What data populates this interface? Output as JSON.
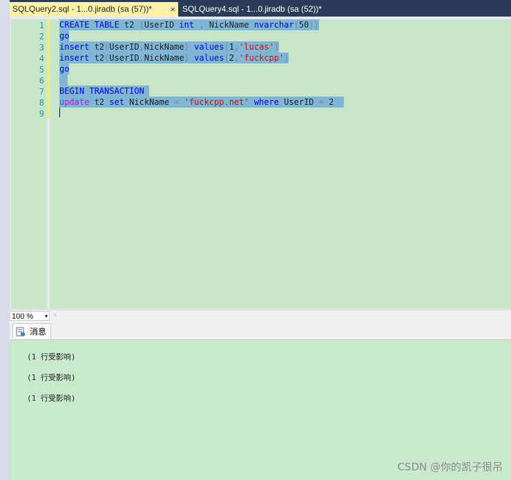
{
  "tabs": [
    {
      "label": "SQLQuery2.sql - 1...0.jiradb (sa (57))*",
      "active": true,
      "close": "×"
    },
    {
      "label": "SQLQuery4.sql - 1...0.jiradb (sa (52))*",
      "active": false
    }
  ],
  "editor": {
    "line_numbers": [
      "1",
      "2",
      "3",
      "4",
      "5",
      "6",
      "7",
      "8",
      "9"
    ],
    "code": {
      "l1": {
        "kw1": "CREATE TABLE",
        "t1": " t2 ",
        "p1": "(",
        "t2": "UserID ",
        "kw2": "int",
        "t3": " ",
        "p2": ",",
        "t4": " NickName ",
        "kw3": "nvarchar",
        "p3": "(",
        "t5": "50",
        "p4": "))"
      },
      "l2": {
        "kw1": "go"
      },
      "l3": {
        "kw1": "insert",
        "t1": " t2",
        "p1": "(",
        "t2": "UserID",
        "p2": ",",
        "t3": "NickName",
        "p3": ")",
        "t4": " ",
        "kw2": "values",
        "p4": "(",
        "t5": "1",
        "p5": ",",
        "s1": "'lucas'",
        "p6": ")"
      },
      "l4": {
        "kw1": "insert",
        "t1": " t2",
        "p1": "(",
        "t2": "UserID",
        "p2": ",",
        "t3": "NickName",
        "p3": ")",
        "t4": " ",
        "kw2": "values",
        "p4": "(",
        "t5": "2",
        "p5": ",",
        "s1": "'fuckcpp'",
        "p6": ")"
      },
      "l5": {
        "kw1": "go"
      },
      "l7": {
        "kw1": "BEGIN TRANSACTION"
      },
      "l8": {
        "kw1": "update",
        "t1": " t2 ",
        "kw2": "set",
        "t2": " NickName ",
        "p1": "=",
        "t3": " ",
        "s1": "'fuckcpp.net'",
        "t4": " ",
        "kw3": "where",
        "t5": " UserID ",
        "p2": "=",
        "t6": " 2"
      }
    },
    "colors": {
      "keyword": "#0000ff",
      "function_keyword": "#e000e0",
      "string": "#e00000",
      "selection": "#7fb5d5",
      "background": "#c7e6c8"
    }
  },
  "zoom": {
    "value": "100 %",
    "arrow": "▾",
    "scroll_left": "‹"
  },
  "results": {
    "tab_label": "消息",
    "messages": [
      "(1 行受影响)",
      "(1 行受影响)",
      "(1 行受影响)"
    ]
  },
  "watermark": "CSDN @你的凯子很吊"
}
